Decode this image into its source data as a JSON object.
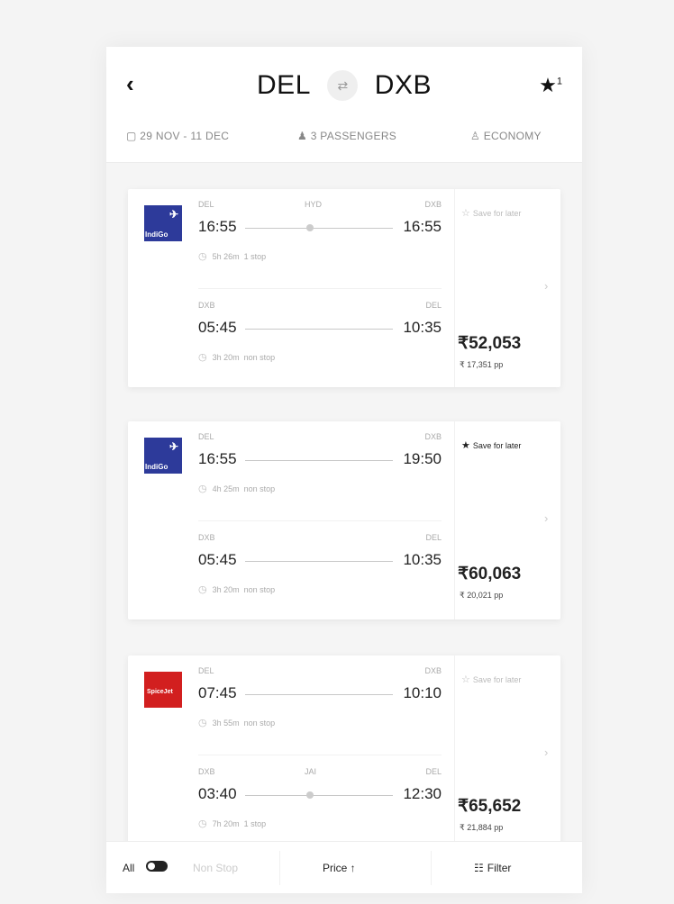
{
  "header": {
    "back_icon": "‹",
    "origin": "DEL",
    "destination": "DXB",
    "swap_icon": "⇄",
    "star_icon": "★",
    "star_count": "1",
    "dates": "29 NOV - 11 DEC",
    "passengers": "3 PASSENGERS",
    "cabin": "ECONOMY"
  },
  "results": [
    {
      "airline_logo": "IndiGo",
      "logo_color": "#2d3a9a",
      "save_label": "Save for later",
      "saved": false,
      "chevron": "›",
      "price": "₹52,053",
      "per_person": "₹ 17,351 pp",
      "outbound": {
        "from": "DEL",
        "via": "HYD",
        "to": "DXB",
        "dep": "16:55",
        "arr": "16:55",
        "duration": "5h 26m",
        "stops": "1 stop"
      },
      "inbound": {
        "from": "DXB",
        "via": "",
        "to": "DEL",
        "dep": "05:45",
        "arr": "10:35",
        "duration": "3h 20m",
        "stops": "non stop"
      }
    },
    {
      "airline_logo": "IndiGo",
      "logo_color": "#2d3a9a",
      "save_label": "Save for later",
      "saved": true,
      "chevron": "›",
      "price": "₹60,063",
      "per_person": "₹ 20,021 pp",
      "outbound": {
        "from": "DEL",
        "via": "",
        "to": "DXB",
        "dep": "16:55",
        "arr": "19:50",
        "duration": "4h 25m",
        "stops": "non stop"
      },
      "inbound": {
        "from": "DXB",
        "via": "",
        "to": "DEL",
        "dep": "05:45",
        "arr": "10:35",
        "duration": "3h 20m",
        "stops": "non stop"
      }
    },
    {
      "airline_logo": "SpiceJet",
      "logo_color": "#d21f1f",
      "save_label": "Save for later",
      "saved": false,
      "chevron": "›",
      "price": "₹65,652",
      "per_person": "₹ 21,884 pp",
      "outbound": {
        "from": "DEL",
        "via": "",
        "to": "DXB",
        "dep": "07:45",
        "arr": "10:10",
        "duration": "3h 55m",
        "stops": "non stop"
      },
      "inbound": {
        "from": "DXB",
        "via": "JAI",
        "to": "DEL",
        "dep": "03:40",
        "arr": "12:30",
        "duration": "7h 20m",
        "stops": "1 stop"
      }
    }
  ],
  "bottom_bar": {
    "all_label": "All",
    "nonstop_label": "Non Stop",
    "sort_label": "Price ↑",
    "filter_icon": "☷",
    "filter_label": "Filter"
  }
}
